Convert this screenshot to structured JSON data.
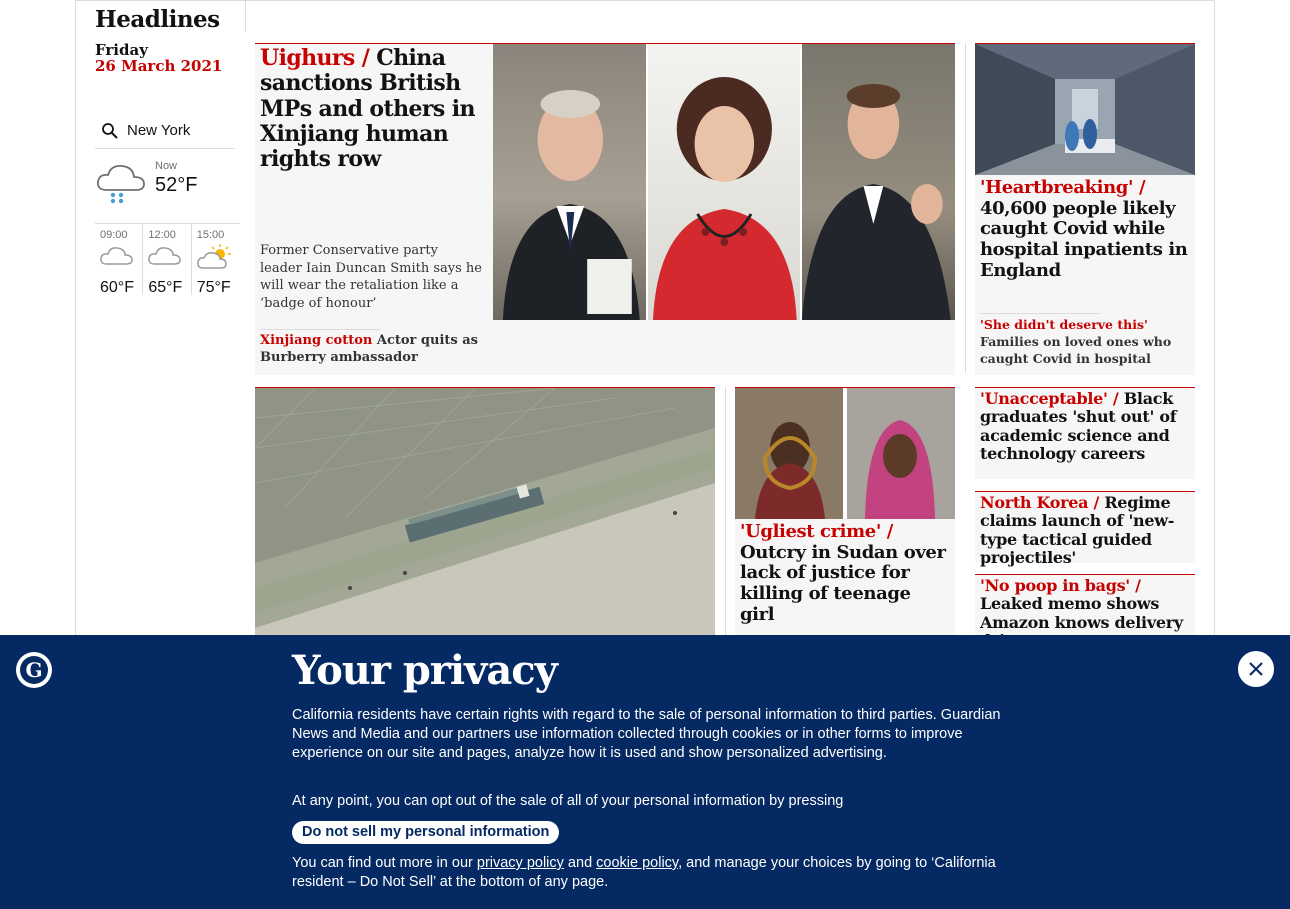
{
  "section": {
    "title": "Headlines",
    "day": "Friday",
    "date": "26 March 2021"
  },
  "weather": {
    "location": "New York",
    "now_label": "Now",
    "now_temp": "52°F",
    "now_icon": "rain-cloud-icon",
    "forecast": [
      {
        "time": "09:00",
        "temp": "60°F",
        "icon": "cloud-icon"
      },
      {
        "time": "12:00",
        "temp": "65°F",
        "icon": "cloud-icon"
      },
      {
        "time": "15:00",
        "temp": "75°F",
        "icon": "sun-cloud-icon"
      }
    ]
  },
  "stories": {
    "main": {
      "kicker": "Uighurs / ",
      "headline": "China sanctions British MPs and others in Xinjiang human rights row",
      "standfirst": "Former Conservative party leader Iain Duncan Smith says he will wear the retaliation like a ‘badge of honour’",
      "sublink_kicker": "Xinjiang cotton ",
      "sublink_text": "Actor quits as Burberry ambassador"
    },
    "covid": {
      "kicker": "'Heartbreaking' / ",
      "headline": "40,600 people likely caught Covid while hospital inpatients in England",
      "sublink_kicker": "'She didn't deserve this' ",
      "sublink_text": "Families on loved ones who caught Covid in hospital"
    },
    "graduates": {
      "kicker": "'Unacceptable'  / ",
      "headline": "Black graduates 'shut out' of academic science and technology careers"
    },
    "korea": {
      "kicker": "North Korea / ",
      "headline": "Regime claims launch of 'new-type tactical guided projectiles'"
    },
    "amazon": {
      "kicker": "'No poop in bags' / ",
      "headline": "Leaked memo shows Amazon knows delivery drivers"
    },
    "sudan": {
      "kicker": "'Ugliest crime' / ",
      "headline": "Outcry in Sudan over lack of justice for killing of teenage girl"
    }
  },
  "privacy": {
    "title": "Your privacy",
    "para1": "California residents have certain rights with regard to the sale of personal information to third parties. Guardian News and Media and our partners use information collected through cookies or in other forms to improve experience on our site and pages, analyze how it is used and show personalized advertising.",
    "para2": "At any point, you can opt out of the sale of all of your personal information by pressing",
    "button": "Do not sell my personal information",
    "para3_start": "You can find out more in our ",
    "privacy_link": "privacy policy",
    "and": " and ",
    "cookie_link": "cookie policy",
    "para3_end": ", and manage your choices by going to ‘California resident – Do Not Sell’ at the bottom of any page."
  },
  "colors": {
    "accent": "#c70000",
    "banner": "#052962",
    "card_bg": "#f6f6f6"
  }
}
